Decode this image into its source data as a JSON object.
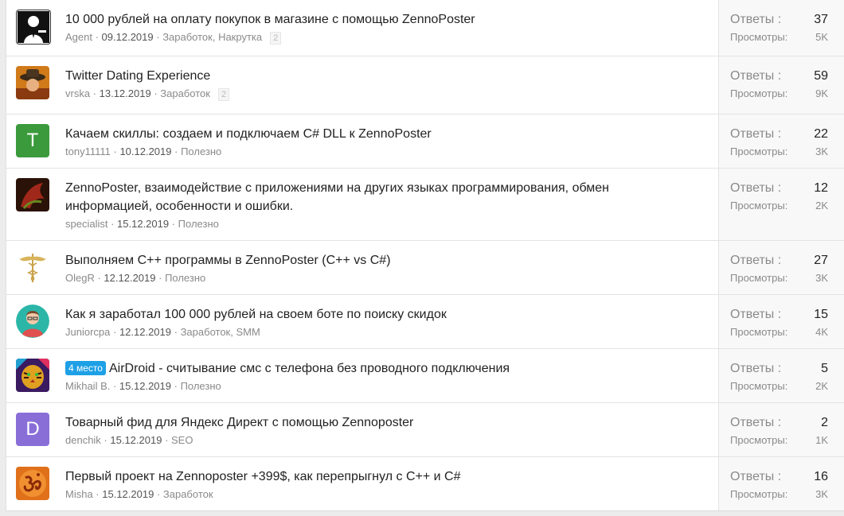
{
  "labels": {
    "replies": "Ответы :",
    "views": "Просмотры:"
  },
  "threads": [
    {
      "title": "10 000 рублей на оплату покупок в магазине с помощью ZennoPoster",
      "author": "Agent",
      "date": "09.12.2019",
      "tags": "Заработок, Накрутка",
      "pages": "2",
      "replies": "37",
      "views": "5K",
      "avatar": {
        "kind": "silhouette-icon",
        "color": "#111111"
      }
    },
    {
      "title": "Twitter Dating Experience",
      "author": "vrska",
      "date": "13.12.2019",
      "tags": "Заработок",
      "pages": "2",
      "replies": "59",
      "views": "9K",
      "avatar": {
        "kind": "hat-figure-icon",
        "color": "#d07a1a"
      }
    },
    {
      "title": "Качаем скиллы: создаем и подключаем C# DLL к ZennoPoster",
      "author": "tony11111",
      "date": "10.12.2019",
      "tags": "Полезно",
      "replies": "22",
      "views": "3K",
      "avatar": {
        "kind": "letter",
        "letter": "T",
        "color": "#3b9a3b"
      }
    },
    {
      "title": "ZennoPoster, взаимодействие с приложениями на других языках программирования, обмен информацией, особенности и ошибки.",
      "author": "specialist",
      "date": "15.12.2019",
      "tags": "Полезно",
      "replies": "12",
      "views": "2K",
      "avatar": {
        "kind": "dragon-icon",
        "color": "#5a2a10"
      }
    },
    {
      "title": "Выполняем C++ программы в ZennoPoster (C++ vs C#)",
      "author": "OlegR",
      "date": "12.12.2019",
      "tags": "Полезно",
      "replies": "27",
      "views": "3K",
      "avatar": {
        "kind": "caduceus-icon",
        "color": "#ffffff"
      }
    },
    {
      "title": "Как я заработал 100 000 рублей на своем боте по поиску скидок",
      "author": "Juniorcpa",
      "date": "12.12.2019",
      "tags": "Заработок, SMM",
      "replies": "15",
      "views": "4K",
      "avatar": {
        "kind": "person-round-icon",
        "color": "#2bb6a8"
      }
    },
    {
      "badge": "4 место",
      "title": "AirDroid - считывание смс с телефона без проводного подключения",
      "author": "Mikhail B.",
      "date": "15.12.2019",
      "tags": "Полезно",
      "replies": "5",
      "views": "2K",
      "avatar": {
        "kind": "tiger-icon",
        "color": "#e0a020"
      }
    },
    {
      "title": "Товарный фид для Яндекс Директ с помощью Zennoposter",
      "author": "denchik",
      "date": "15.12.2019",
      "tags": "SEO",
      "replies": "2",
      "views": "1K",
      "avatar": {
        "kind": "letter",
        "letter": "D",
        "color": "#8a6ed8"
      }
    },
    {
      "title": "Первый проект на Zennoposter +399$, как перепрыгнул с C++ и C#",
      "author": "Misha",
      "date": "15.12.2019",
      "tags": "Заработок",
      "replies": "16",
      "views": "3K",
      "avatar": {
        "kind": "om-icon",
        "color": "#e0701a"
      }
    }
  ]
}
